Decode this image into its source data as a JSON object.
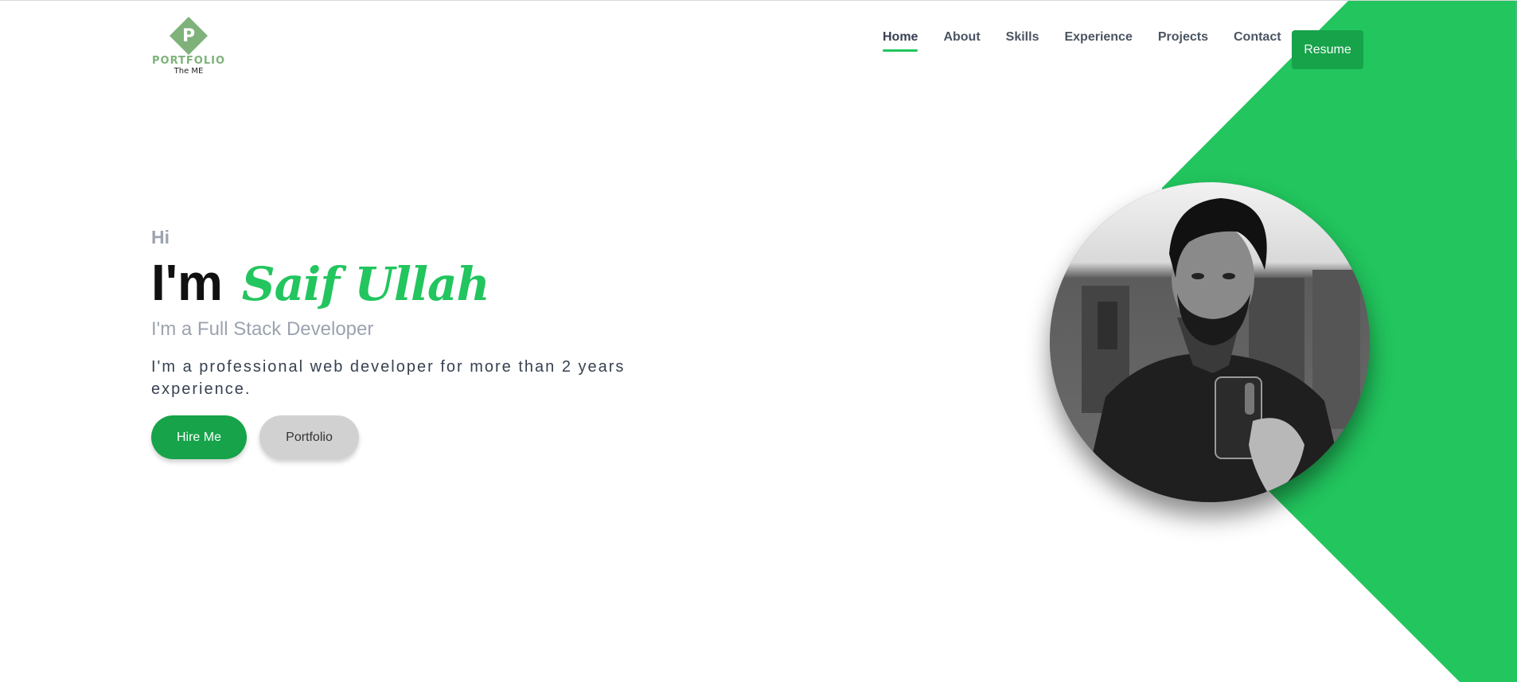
{
  "header": {
    "logo": {
      "wordmark": "PORTFOLIO",
      "tagline": "The ME",
      "letter": "P"
    },
    "nav": [
      {
        "label": "Home",
        "active": true
      },
      {
        "label": "About",
        "active": false
      },
      {
        "label": "Skills",
        "active": false
      },
      {
        "label": "Experience",
        "active": false
      },
      {
        "label": "Projects",
        "active": false
      },
      {
        "label": "Contact",
        "active": false
      }
    ],
    "resume_label": "Resume"
  },
  "hero": {
    "greeting": "Hi",
    "intro_prefix": "I'm",
    "name": "Saif Ullah",
    "role": "I'm a Full Stack Developer",
    "description": "I'm a professional web developer for more than 2 years experience.",
    "primary_cta": "Hire Me",
    "secondary_cta": "Portfolio"
  },
  "colors": {
    "accent": "#22c55e",
    "button": "#16a34a",
    "logo": "#7eb27a"
  },
  "icons": {
    "logo": "portfolio-logo-icon",
    "avatar": "profile-photo"
  }
}
